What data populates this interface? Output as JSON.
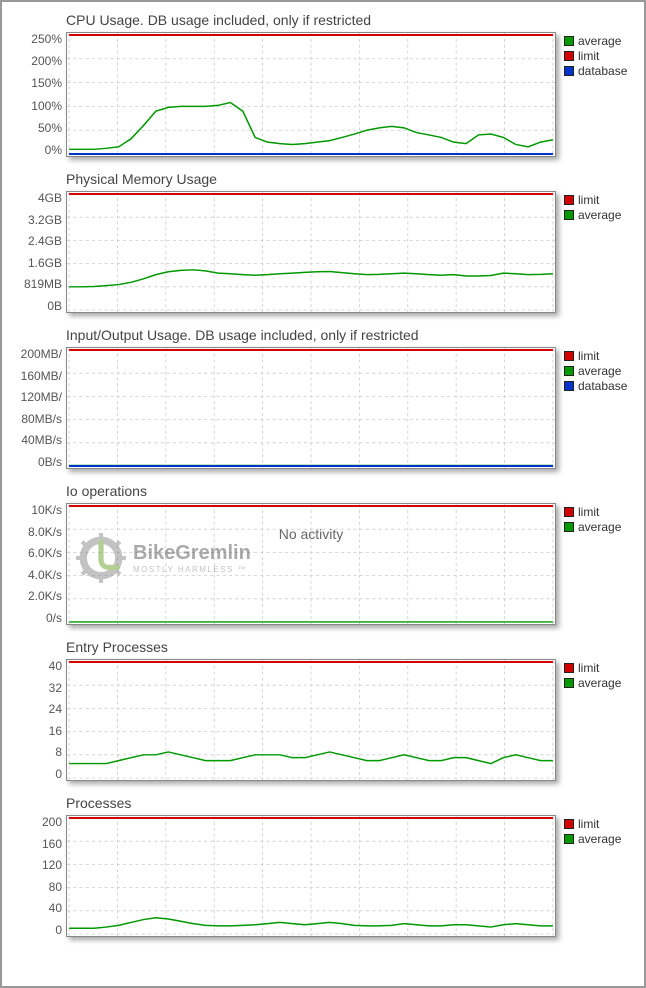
{
  "watermark": {
    "title": "BikeGremlin",
    "subtitle": "MOSTLY HARMLESS ™"
  },
  "legend_colors": {
    "average": "#009900",
    "limit": "#d40000",
    "database": "#0033cc"
  },
  "chart_data": [
    {
      "type": "line",
      "title": "CPU Usage. DB usage included, only if restricted",
      "xlabel": "",
      "ylabel": "",
      "ylim": [
        0,
        250
      ],
      "ytick_labels": [
        "250%",
        "200%",
        "150%",
        "100%",
        "50%",
        "0%"
      ],
      "legend": [
        "average",
        "limit",
        "database"
      ],
      "x": [
        0,
        1,
        2,
        3,
        4,
        5,
        6,
        7,
        8,
        9,
        10,
        11,
        12,
        13,
        14,
        15,
        16,
        17,
        18,
        19,
        20,
        21,
        22,
        23,
        24,
        25,
        26,
        27,
        28,
        29,
        30,
        31,
        32,
        33,
        34,
        35,
        36,
        37,
        38,
        39
      ],
      "series": [
        {
          "name": "average",
          "values": [
            10,
            10,
            10,
            12,
            15,
            32,
            60,
            90,
            98,
            100,
            100,
            100,
            102,
            108,
            90,
            35,
            25,
            22,
            20,
            22,
            25,
            28,
            35,
            42,
            50,
            55,
            58,
            55,
            45,
            40,
            35,
            25,
            22,
            40,
            42,
            35,
            20,
            15,
            25,
            30
          ]
        },
        {
          "name": "limit",
          "values": [
            250,
            250,
            250,
            250,
            250,
            250,
            250,
            250,
            250,
            250,
            250,
            250,
            250,
            250,
            250,
            250,
            250,
            250,
            250,
            250,
            250,
            250,
            250,
            250,
            250,
            250,
            250,
            250,
            250,
            250,
            250,
            250,
            250,
            250,
            250,
            250,
            250,
            250,
            250,
            250
          ]
        },
        {
          "name": "database",
          "values": [
            0,
            0,
            0,
            0,
            0,
            0,
            0,
            0,
            0,
            0,
            0,
            0,
            0,
            0,
            0,
            0,
            0,
            0,
            0,
            0,
            0,
            0,
            0,
            0,
            0,
            0,
            0,
            0,
            0,
            0,
            0,
            0,
            0,
            0,
            0,
            0,
            0,
            0,
            0,
            0
          ]
        }
      ],
      "height": 125
    },
    {
      "type": "line",
      "title": "Physical Memory Usage",
      "xlabel": "",
      "ylabel": "",
      "ylim": [
        0,
        4096
      ],
      "ytick_labels": [
        "4GB",
        "3.2GB",
        "2.4GB",
        "1.6GB",
        "819MB",
        "0B"
      ],
      "legend": [
        "limit",
        "average"
      ],
      "x": [
        0,
        1,
        2,
        3,
        4,
        5,
        6,
        7,
        8,
        9,
        10,
        11,
        12,
        13,
        14,
        15,
        16,
        17,
        18,
        19,
        20,
        21,
        22,
        23,
        24,
        25,
        26,
        27,
        28,
        29,
        30,
        31,
        32,
        33,
        34,
        35,
        36,
        37,
        38,
        39
      ],
      "series": [
        {
          "name": "limit",
          "values": [
            4096,
            4096,
            4096,
            4096,
            4096,
            4096,
            4096,
            4096,
            4096,
            4096,
            4096,
            4096,
            4096,
            4096,
            4096,
            4096,
            4096,
            4096,
            4096,
            4096,
            4096,
            4096,
            4096,
            4096,
            4096,
            4096,
            4096,
            4096,
            4096,
            4096,
            4096,
            4096,
            4096,
            4096,
            4096,
            4096,
            4096,
            4096,
            4096,
            4096
          ]
        },
        {
          "name": "average",
          "values": [
            819,
            820,
            830,
            860,
            900,
            980,
            1100,
            1250,
            1350,
            1400,
            1420,
            1380,
            1300,
            1280,
            1250,
            1230,
            1250,
            1280,
            1300,
            1330,
            1350,
            1360,
            1320,
            1280,
            1250,
            1260,
            1280,
            1300,
            1280,
            1250,
            1230,
            1250,
            1200,
            1200,
            1220,
            1300,
            1280,
            1250,
            1260,
            1280
          ]
        }
      ],
      "height": 122
    },
    {
      "type": "line",
      "title": "Input/Output Usage. DB usage included, only if restricted",
      "xlabel": "",
      "ylabel": "",
      "ylim": [
        0,
        200
      ],
      "ytick_labels": [
        "200MB/",
        "160MB/",
        "120MB/",
        "80MB/s",
        "40MB/s",
        "0B/s"
      ],
      "legend": [
        "limit",
        "average",
        "database"
      ],
      "x": [
        0,
        1,
        2,
        3,
        4,
        5,
        6,
        7,
        8,
        9,
        10,
        11,
        12,
        13,
        14,
        15,
        16,
        17,
        18,
        19,
        20,
        21,
        22,
        23,
        24,
        25,
        26,
        27,
        28,
        29,
        30,
        31,
        32,
        33,
        34,
        35,
        36,
        37,
        38,
        39
      ],
      "series": [
        {
          "name": "limit",
          "values": [
            200,
            200,
            200,
            200,
            200,
            200,
            200,
            200,
            200,
            200,
            200,
            200,
            200,
            200,
            200,
            200,
            200,
            200,
            200,
            200,
            200,
            200,
            200,
            200,
            200,
            200,
            200,
            200,
            200,
            200,
            200,
            200,
            200,
            200,
            200,
            200,
            200,
            200,
            200,
            200
          ]
        },
        {
          "name": "average",
          "values": [
            1,
            1,
            1,
            1,
            1,
            1,
            1,
            1,
            1,
            1,
            1,
            1,
            1,
            1,
            1,
            1,
            1,
            1,
            1,
            1,
            1,
            1,
            1,
            1,
            1,
            1,
            1,
            1,
            1,
            1,
            1,
            1,
            1,
            1,
            1,
            1,
            1,
            1,
            1,
            1
          ]
        },
        {
          "name": "database",
          "values": [
            0,
            0,
            0,
            0,
            0,
            0,
            0,
            0,
            0,
            0,
            0,
            0,
            0,
            0,
            0,
            0,
            0,
            0,
            0,
            0,
            0,
            0,
            0,
            0,
            0,
            0,
            0,
            0,
            0,
            0,
            0,
            0,
            0,
            0,
            0,
            0,
            0,
            0,
            0,
            0
          ]
        }
      ],
      "height": 122
    },
    {
      "type": "line",
      "title": "Io operations",
      "xlabel": "",
      "ylabel": "",
      "ylim": [
        0,
        10000
      ],
      "ytick_labels": [
        "10K/s",
        "8.0K/s",
        "6.0K/s",
        "4.0K/s",
        "2.0K/s",
        "0/s"
      ],
      "legend": [
        "limit",
        "average"
      ],
      "annotation": "No activity",
      "watermark": true,
      "x": [
        0,
        1,
        2,
        3,
        4,
        5,
        6,
        7,
        8,
        9,
        10,
        11,
        12,
        13,
        14,
        15,
        16,
        17,
        18,
        19,
        20,
        21,
        22,
        23,
        24,
        25,
        26,
        27,
        28,
        29,
        30,
        31,
        32,
        33,
        34,
        35,
        36,
        37,
        38,
        39
      ],
      "series": [
        {
          "name": "limit",
          "values": [
            10000,
            10000,
            10000,
            10000,
            10000,
            10000,
            10000,
            10000,
            10000,
            10000,
            10000,
            10000,
            10000,
            10000,
            10000,
            10000,
            10000,
            10000,
            10000,
            10000,
            10000,
            10000,
            10000,
            10000,
            10000,
            10000,
            10000,
            10000,
            10000,
            10000,
            10000,
            10000,
            10000,
            10000,
            10000,
            10000,
            10000,
            10000,
            10000,
            10000
          ]
        },
        {
          "name": "average",
          "values": [
            10,
            10,
            10,
            10,
            10,
            10,
            10,
            10,
            10,
            10,
            10,
            10,
            10,
            10,
            10,
            10,
            10,
            10,
            10,
            10,
            10,
            10,
            10,
            10,
            10,
            10,
            10,
            10,
            10,
            10,
            10,
            10,
            10,
            10,
            10,
            10,
            10,
            10,
            10,
            10
          ]
        }
      ],
      "height": 122
    },
    {
      "type": "line",
      "title": "Entry Processes",
      "xlabel": "",
      "ylabel": "",
      "ylim": [
        0,
        40
      ],
      "ytick_labels": [
        "40",
        "32",
        "24",
        "16",
        "8",
        "0"
      ],
      "legend": [
        "limit",
        "average"
      ],
      "x": [
        0,
        1,
        2,
        3,
        4,
        5,
        6,
        7,
        8,
        9,
        10,
        11,
        12,
        13,
        14,
        15,
        16,
        17,
        18,
        19,
        20,
        21,
        22,
        23,
        24,
        25,
        26,
        27,
        28,
        29,
        30,
        31,
        32,
        33,
        34,
        35,
        36,
        37,
        38,
        39
      ],
      "series": [
        {
          "name": "limit",
          "values": [
            40,
            40,
            40,
            40,
            40,
            40,
            40,
            40,
            40,
            40,
            40,
            40,
            40,
            40,
            40,
            40,
            40,
            40,
            40,
            40,
            40,
            40,
            40,
            40,
            40,
            40,
            40,
            40,
            40,
            40,
            40,
            40,
            40,
            40,
            40,
            40,
            40,
            40,
            40,
            40
          ]
        },
        {
          "name": "average",
          "values": [
            5,
            5,
            5,
            5,
            6,
            7,
            8,
            8,
            9,
            8,
            7,
            6,
            6,
            6,
            7,
            8,
            8,
            8,
            7,
            7,
            8,
            9,
            8,
            7,
            6,
            6,
            7,
            8,
            7,
            6,
            6,
            7,
            7,
            6,
            5,
            7,
            8,
            7,
            6,
            6
          ]
        }
      ],
      "height": 122
    },
    {
      "type": "line",
      "title": "Processes",
      "xlabel": "",
      "ylabel": "",
      "ylim": [
        0,
        200
      ],
      "ytick_labels": [
        "200",
        "160",
        "120",
        "80",
        "40",
        "0"
      ],
      "legend": [
        "limit",
        "average"
      ],
      "x": [
        0,
        1,
        2,
        3,
        4,
        5,
        6,
        7,
        8,
        9,
        10,
        11,
        12,
        13,
        14,
        15,
        16,
        17,
        18,
        19,
        20,
        21,
        22,
        23,
        24,
        25,
        26,
        27,
        28,
        29,
        30,
        31,
        32,
        33,
        34,
        35,
        36,
        37,
        38,
        39
      ],
      "series": [
        {
          "name": "limit",
          "values": [
            200,
            200,
            200,
            200,
            200,
            200,
            200,
            200,
            200,
            200,
            200,
            200,
            200,
            200,
            200,
            200,
            200,
            200,
            200,
            200,
            200,
            200,
            200,
            200,
            200,
            200,
            200,
            200,
            200,
            200,
            200,
            200,
            200,
            200,
            200,
            200,
            200,
            200,
            200,
            200
          ]
        },
        {
          "name": "average",
          "values": [
            10,
            10,
            10,
            12,
            15,
            20,
            25,
            28,
            26,
            22,
            18,
            15,
            14,
            14,
            15,
            16,
            18,
            20,
            18,
            16,
            18,
            20,
            18,
            15,
            14,
            14,
            15,
            18,
            16,
            14,
            14,
            16,
            16,
            14,
            12,
            16,
            18,
            16,
            14,
            14
          ]
        }
      ],
      "height": 122
    }
  ]
}
